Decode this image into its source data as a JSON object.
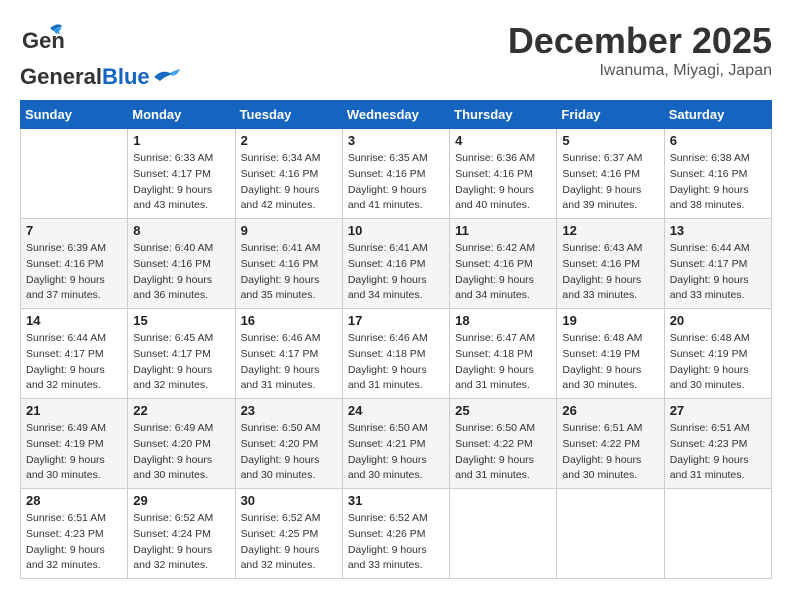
{
  "header": {
    "logo_general": "General",
    "logo_blue": "Blue",
    "month": "December 2025",
    "location": "Iwanuma, Miyagi, Japan"
  },
  "weekdays": [
    "Sunday",
    "Monday",
    "Tuesday",
    "Wednesday",
    "Thursday",
    "Friday",
    "Saturday"
  ],
  "weeks": [
    [
      {
        "day": "",
        "sunrise": "",
        "sunset": "",
        "daylight": ""
      },
      {
        "day": "1",
        "sunrise": "Sunrise: 6:33 AM",
        "sunset": "Sunset: 4:17 PM",
        "daylight": "Daylight: 9 hours and 43 minutes."
      },
      {
        "day": "2",
        "sunrise": "Sunrise: 6:34 AM",
        "sunset": "Sunset: 4:16 PM",
        "daylight": "Daylight: 9 hours and 42 minutes."
      },
      {
        "day": "3",
        "sunrise": "Sunrise: 6:35 AM",
        "sunset": "Sunset: 4:16 PM",
        "daylight": "Daylight: 9 hours and 41 minutes."
      },
      {
        "day": "4",
        "sunrise": "Sunrise: 6:36 AM",
        "sunset": "Sunset: 4:16 PM",
        "daylight": "Daylight: 9 hours and 40 minutes."
      },
      {
        "day": "5",
        "sunrise": "Sunrise: 6:37 AM",
        "sunset": "Sunset: 4:16 PM",
        "daylight": "Daylight: 9 hours and 39 minutes."
      },
      {
        "day": "6",
        "sunrise": "Sunrise: 6:38 AM",
        "sunset": "Sunset: 4:16 PM",
        "daylight": "Daylight: 9 hours and 38 minutes."
      }
    ],
    [
      {
        "day": "7",
        "sunrise": "Sunrise: 6:39 AM",
        "sunset": "Sunset: 4:16 PM",
        "daylight": "Daylight: 9 hours and 37 minutes."
      },
      {
        "day": "8",
        "sunrise": "Sunrise: 6:40 AM",
        "sunset": "Sunset: 4:16 PM",
        "daylight": "Daylight: 9 hours and 36 minutes."
      },
      {
        "day": "9",
        "sunrise": "Sunrise: 6:41 AM",
        "sunset": "Sunset: 4:16 PM",
        "daylight": "Daylight: 9 hours and 35 minutes."
      },
      {
        "day": "10",
        "sunrise": "Sunrise: 6:41 AM",
        "sunset": "Sunset: 4:16 PM",
        "daylight": "Daylight: 9 hours and 34 minutes."
      },
      {
        "day": "11",
        "sunrise": "Sunrise: 6:42 AM",
        "sunset": "Sunset: 4:16 PM",
        "daylight": "Daylight: 9 hours and 34 minutes."
      },
      {
        "day": "12",
        "sunrise": "Sunrise: 6:43 AM",
        "sunset": "Sunset: 4:16 PM",
        "daylight": "Daylight: 9 hours and 33 minutes."
      },
      {
        "day": "13",
        "sunrise": "Sunrise: 6:44 AM",
        "sunset": "Sunset: 4:17 PM",
        "daylight": "Daylight: 9 hours and 33 minutes."
      }
    ],
    [
      {
        "day": "14",
        "sunrise": "Sunrise: 6:44 AM",
        "sunset": "Sunset: 4:17 PM",
        "daylight": "Daylight: 9 hours and 32 minutes."
      },
      {
        "day": "15",
        "sunrise": "Sunrise: 6:45 AM",
        "sunset": "Sunset: 4:17 PM",
        "daylight": "Daylight: 9 hours and 32 minutes."
      },
      {
        "day": "16",
        "sunrise": "Sunrise: 6:46 AM",
        "sunset": "Sunset: 4:17 PM",
        "daylight": "Daylight: 9 hours and 31 minutes."
      },
      {
        "day": "17",
        "sunrise": "Sunrise: 6:46 AM",
        "sunset": "Sunset: 4:18 PM",
        "daylight": "Daylight: 9 hours and 31 minutes."
      },
      {
        "day": "18",
        "sunrise": "Sunrise: 6:47 AM",
        "sunset": "Sunset: 4:18 PM",
        "daylight": "Daylight: 9 hours and 31 minutes."
      },
      {
        "day": "19",
        "sunrise": "Sunrise: 6:48 AM",
        "sunset": "Sunset: 4:19 PM",
        "daylight": "Daylight: 9 hours and 30 minutes."
      },
      {
        "day": "20",
        "sunrise": "Sunrise: 6:48 AM",
        "sunset": "Sunset: 4:19 PM",
        "daylight": "Daylight: 9 hours and 30 minutes."
      }
    ],
    [
      {
        "day": "21",
        "sunrise": "Sunrise: 6:49 AM",
        "sunset": "Sunset: 4:19 PM",
        "daylight": "Daylight: 9 hours and 30 minutes."
      },
      {
        "day": "22",
        "sunrise": "Sunrise: 6:49 AM",
        "sunset": "Sunset: 4:20 PM",
        "daylight": "Daylight: 9 hours and 30 minutes."
      },
      {
        "day": "23",
        "sunrise": "Sunrise: 6:50 AM",
        "sunset": "Sunset: 4:20 PM",
        "daylight": "Daylight: 9 hours and 30 minutes."
      },
      {
        "day": "24",
        "sunrise": "Sunrise: 6:50 AM",
        "sunset": "Sunset: 4:21 PM",
        "daylight": "Daylight: 9 hours and 30 minutes."
      },
      {
        "day": "25",
        "sunrise": "Sunrise: 6:50 AM",
        "sunset": "Sunset: 4:22 PM",
        "daylight": "Daylight: 9 hours and 31 minutes."
      },
      {
        "day": "26",
        "sunrise": "Sunrise: 6:51 AM",
        "sunset": "Sunset: 4:22 PM",
        "daylight": "Daylight: 9 hours and 30 minutes."
      },
      {
        "day": "27",
        "sunrise": "Sunrise: 6:51 AM",
        "sunset": "Sunset: 4:23 PM",
        "daylight": "Daylight: 9 hours and 31 minutes."
      }
    ],
    [
      {
        "day": "28",
        "sunrise": "Sunrise: 6:51 AM",
        "sunset": "Sunset: 4:23 PM",
        "daylight": "Daylight: 9 hours and 32 minutes."
      },
      {
        "day": "29",
        "sunrise": "Sunrise: 6:52 AM",
        "sunset": "Sunset: 4:24 PM",
        "daylight": "Daylight: 9 hours and 32 minutes."
      },
      {
        "day": "30",
        "sunrise": "Sunrise: 6:52 AM",
        "sunset": "Sunset: 4:25 PM",
        "daylight": "Daylight: 9 hours and 32 minutes."
      },
      {
        "day": "31",
        "sunrise": "Sunrise: 6:52 AM",
        "sunset": "Sunset: 4:26 PM",
        "daylight": "Daylight: 9 hours and 33 minutes."
      },
      {
        "day": "",
        "sunrise": "",
        "sunset": "",
        "daylight": ""
      },
      {
        "day": "",
        "sunrise": "",
        "sunset": "",
        "daylight": ""
      },
      {
        "day": "",
        "sunrise": "",
        "sunset": "",
        "daylight": ""
      }
    ]
  ]
}
